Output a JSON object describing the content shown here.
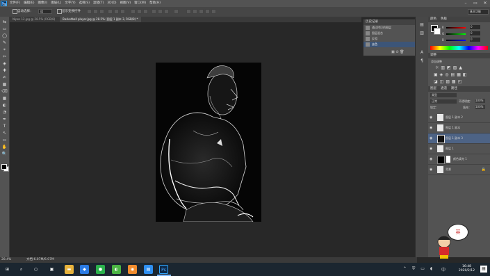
{
  "app": {
    "logo": "Ps"
  },
  "menu": [
    "文件(F)",
    "编辑(E)",
    "图像(I)",
    "图层(L)",
    "文字(Y)",
    "选择(S)",
    "滤镜(T)",
    "3D(D)",
    "视图(V)",
    "窗口(W)",
    "帮助(H)"
  ],
  "window_controls": {
    "minimize": "–",
    "restore": "▭",
    "close": "✕"
  },
  "options": {
    "tool_icon": "⇆",
    "auto_select_label": "自动选择：",
    "auto_select_value": "组",
    "show_transform_label": "显示变换控件",
    "workspace": "基本功能"
  },
  "tabs": [
    {
      "label": "Nipes 12.jpg @ 28.5% (RGB/8)"
    },
    {
      "label": "Basketball player.jpg @ 28.5% (图层 1 副本 3, RGB/8) *"
    }
  ],
  "tools": [
    "⇆",
    "▭",
    "◯",
    "✎",
    "⌖",
    "✂",
    "◈",
    "✚",
    "✍",
    "▩",
    "⌫",
    "▦",
    "◐",
    "◔",
    "✒",
    "T",
    "↖",
    "▭",
    "✋",
    "🔍"
  ],
  "history": {
    "title": "历史记录",
    "items": [
      {
        "label": "通过拷贝的图层"
      },
      {
        "label": "图层混合"
      },
      {
        "label": "反相"
      },
      {
        "label": "去色"
      }
    ]
  },
  "color_panel": {
    "tabs": [
      "颜色",
      "色板"
    ],
    "r_label": "R",
    "r_value": "0",
    "g_label": "G",
    "g_value": "0",
    "b_label": "B",
    "b_value": "0"
  },
  "adjustments": {
    "title": "调整",
    "subtitle": "添加调整"
  },
  "layers_panel": {
    "tabs": [
      "图层",
      "通道",
      "路径"
    ],
    "kind": "类型",
    "blend_mode": "正常",
    "opacity_label": "不透明度：",
    "opacity_value": "100%",
    "lock_label": "锁定：",
    "fill_label": "填充：",
    "fill_value": "100%",
    "layers": [
      {
        "name": "图层 1 副本 2",
        "selected": false
      },
      {
        "name": "图层 1 副本",
        "selected": false
      },
      {
        "name": "图层 1 副本 3",
        "selected": true
      },
      {
        "name": "图层 1",
        "selected": false
      },
      {
        "name": "颜色填充 1",
        "selected": false
      },
      {
        "name": "背景",
        "selected": false
      }
    ]
  },
  "status": {
    "zoom": "28.4%",
    "doc": "文档:6.07M/6.07M"
  },
  "taskbar": {
    "time": "16:48",
    "date": "2020/2/12",
    "lang": "中",
    "icons": [
      {
        "name": "start",
        "glyph": "⊞",
        "color": "#1b2630"
      },
      {
        "name": "search",
        "glyph": "⌕",
        "color": "#1b2630"
      },
      {
        "name": "cortana",
        "glyph": "○",
        "color": "#1b2630"
      },
      {
        "name": "taskview",
        "glyph": "▣",
        "color": "#1b2630"
      },
      {
        "name": "explorer",
        "glyph": "▬",
        "color": "#e8b33c"
      },
      {
        "name": "app-blue",
        "glyph": "◆",
        "color": "#2a7be4"
      },
      {
        "name": "wechat",
        "glyph": "●",
        "color": "#2bb24c"
      },
      {
        "name": "app-green",
        "glyph": "◐",
        "color": "#4bb543"
      },
      {
        "name": "app-orange",
        "glyph": "◉",
        "color": "#f08c2e"
      },
      {
        "name": "app-blue2",
        "glyph": "▤",
        "color": "#2f8ff0"
      },
      {
        "name": "photoshop",
        "glyph": "Ps",
        "color": "#0d2a4a"
      }
    ]
  },
  "sticker": {
    "text": "英"
  }
}
